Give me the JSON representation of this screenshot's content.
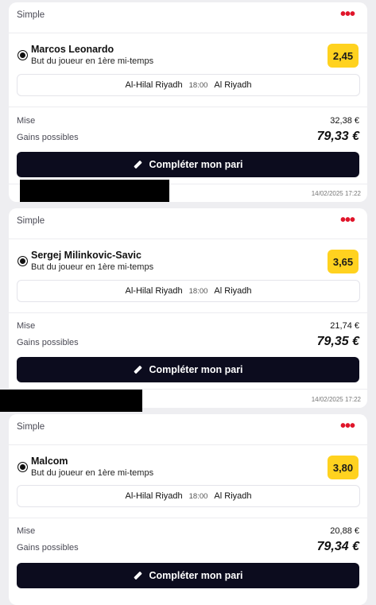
{
  "bets": [
    {
      "type": "Simple",
      "player": "Marcos Leonardo",
      "market": "But du joueur en 1ère mi-temps",
      "odds": "2,45",
      "home": "Al-Hilal Riyadh",
      "time": "18:00",
      "away": "Al Riyadh",
      "stake_label": "Mise",
      "stake": "32,38 €",
      "gain_label": "Gains possibles",
      "gain": "79,33 €",
      "cta": "Compléter mon pari",
      "date": "14/02/2025 17:22"
    },
    {
      "type": "Simple",
      "player": "Sergej Milinkovic-Savic",
      "market": "But du joueur en 1ère mi-temps",
      "odds": "3,65",
      "home": "Al-Hilal Riyadh",
      "time": "18:00",
      "away": "Al Riyadh",
      "stake_label": "Mise",
      "stake": "21,74 €",
      "gain_label": "Gains possibles",
      "gain": "79,35 €",
      "cta": "Compléter mon pari",
      "date": "14/02/2025 17:22"
    },
    {
      "type": "Simple",
      "player": "Malcom",
      "market": "But du joueur en 1ère mi-temps",
      "odds": "3,80",
      "home": "Al-Hilal Riyadh",
      "time": "18:00",
      "away": "Al Riyadh",
      "stake_label": "Mise",
      "stake": "20,88 €",
      "gain_label": "Gains possibles",
      "gain": "79,34 €",
      "cta": "Compléter mon pari"
    }
  ],
  "icons": {
    "menu": "more-dots-icon",
    "sport": "soccer-ball-icon",
    "cta": "pencil-icon"
  },
  "colors": {
    "accent": "#ffd21f",
    "menu_dots": "#e0152a",
    "cta_bg": "#0c0c1e"
  }
}
